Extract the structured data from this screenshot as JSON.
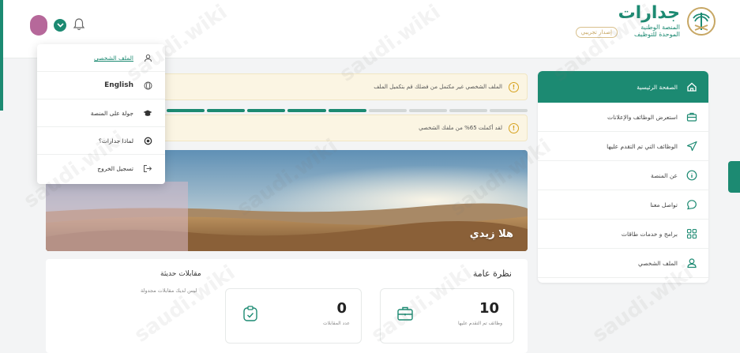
{
  "brand": {
    "name": "جدارات",
    "line1": "المنصة الوطنية",
    "line2": "الموحدة للتوظيف",
    "badge": "إصدار تجريبي"
  },
  "sidebar": {
    "items": [
      {
        "label": "الصفحة الرئيسية",
        "icon": "home-icon",
        "active": true
      },
      {
        "label": "استعرض الوظائف والإعلانات",
        "icon": "briefcase-icon"
      },
      {
        "label": "الوظائف التي تم التقدم عليها",
        "icon": "send-icon"
      },
      {
        "label": "عن المنصة",
        "icon": "info-icon"
      },
      {
        "label": "تواصل معنا",
        "icon": "chat-icon"
      },
      {
        "label": "برامج و خدمات طاقات",
        "icon": "grid-icon"
      },
      {
        "label": "الملف الشخصي",
        "icon": "user-icon"
      }
    ]
  },
  "alerts": [
    {
      "text": "الملف الشخصي غير مكتمل من فضلك قم بتكميل الملف"
    },
    {
      "text": "لقد أكملت 65% من ملفك الشخصي"
    }
  ],
  "profile_progress": 0.65,
  "banner": {
    "welcome": "هلا زيدي"
  },
  "overview": {
    "title": "نظرة عامة",
    "stats": [
      {
        "value": "10",
        "label": "وظائف تم التقدم عليها",
        "icon": "briefcase-icon"
      },
      {
        "value": "0",
        "label": "عدد المقابلات",
        "icon": "clipboard-icon"
      }
    ],
    "interviews_title": "مقابلات حديثة",
    "interviews_note": "ليس لديك مقابلات مجدولة"
  },
  "dropdown": {
    "items": [
      {
        "label": "الملف الشخصي",
        "icon": "user-icon",
        "link": true
      },
      {
        "label": "English",
        "icon": "globe-icon",
        "english": true
      },
      {
        "label": "جولة على المنصة",
        "icon": "graduation-cap-icon"
      },
      {
        "label": "لماذا جدارات؟",
        "icon": "target-icon"
      },
      {
        "label": "تسجيل الخروج",
        "icon": "logout-icon"
      }
    ]
  },
  "watermark": "saudi.wiki",
  "colors": {
    "primary": "#1c8a72",
    "warning": "#d6a21e",
    "alert_bg": "#fbf5e3"
  }
}
